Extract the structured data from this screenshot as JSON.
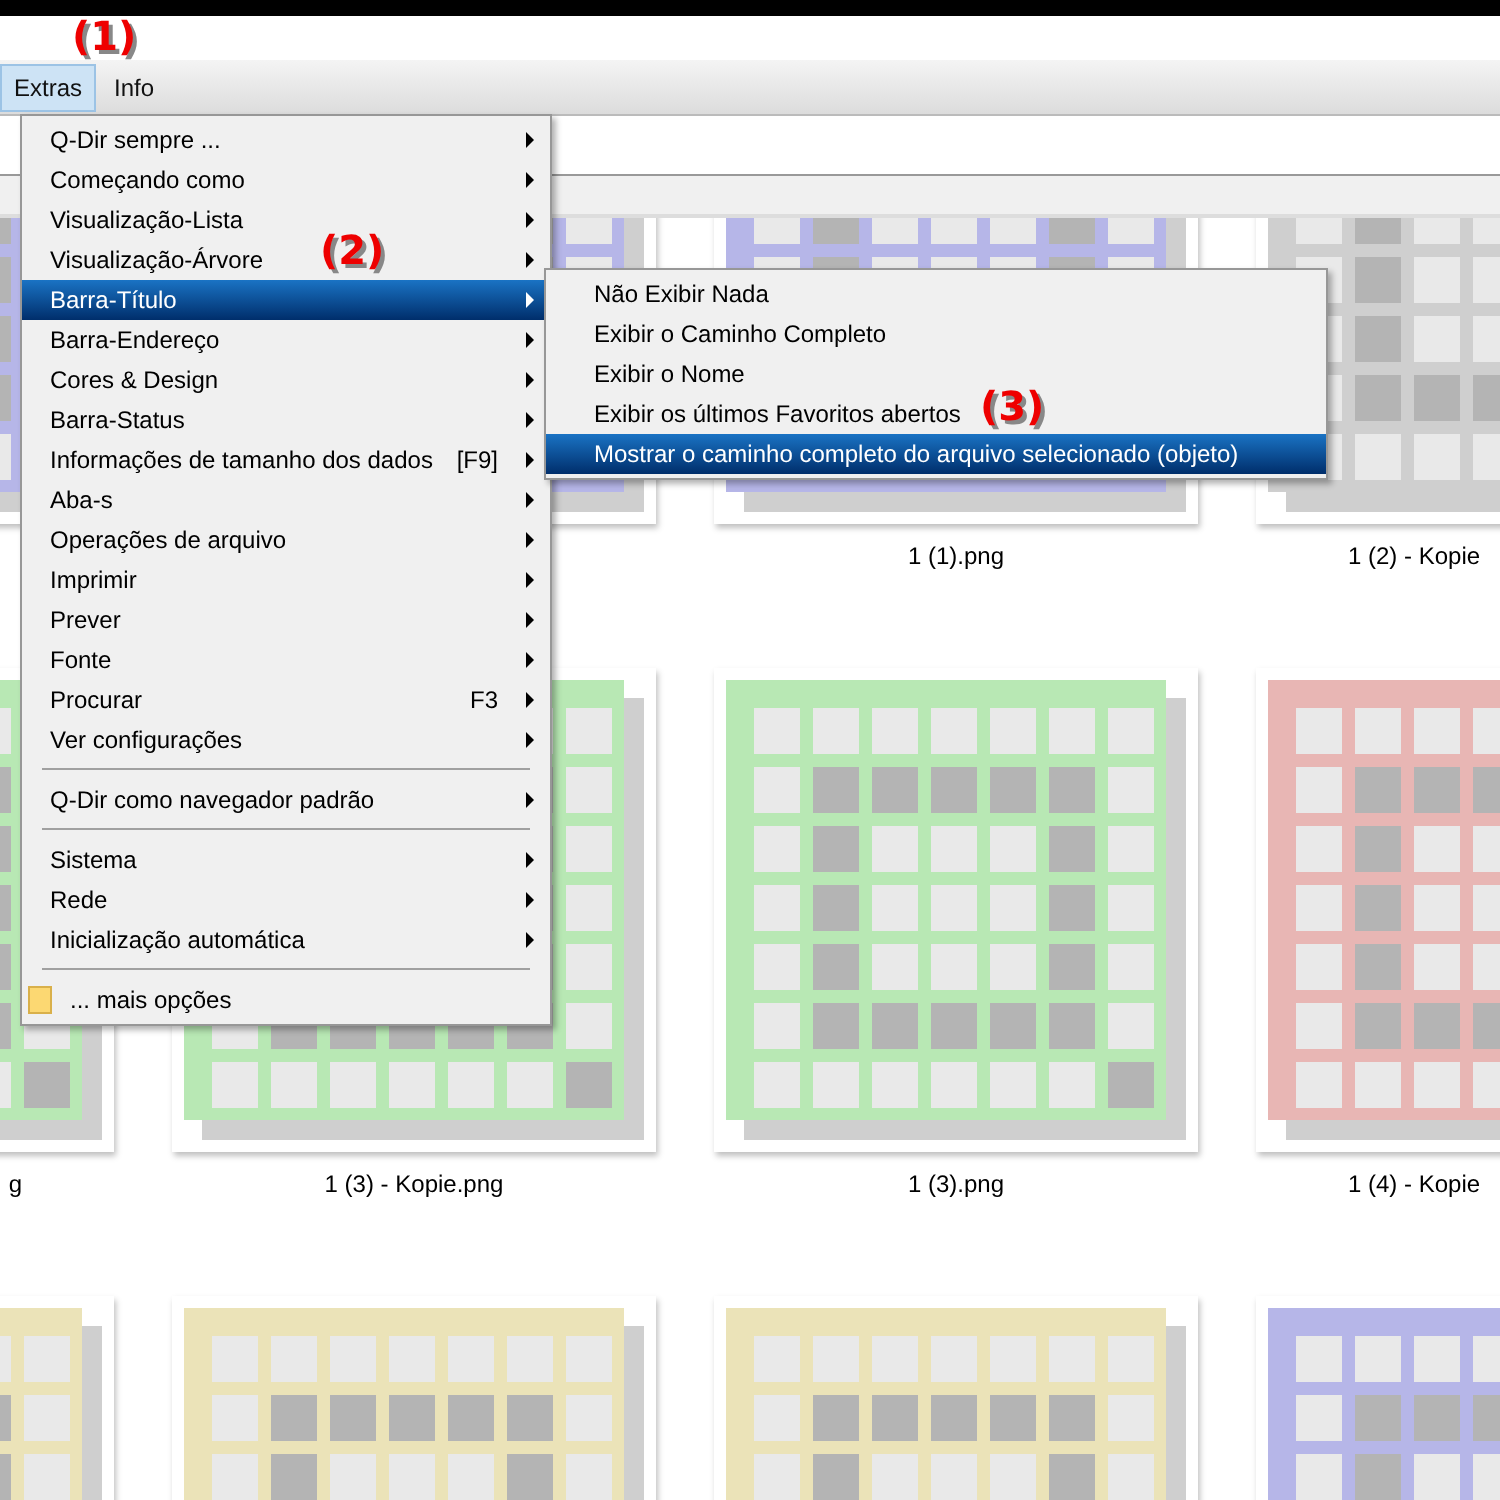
{
  "menubar": [
    {
      "label": "Extras",
      "selected": true
    },
    {
      "label": "Info",
      "selected": false
    }
  ],
  "menu": [
    {
      "kind": "item",
      "label": "Q-Dir sempre ...",
      "submenu": true,
      "selected": false
    },
    {
      "kind": "item",
      "label": "Começando como",
      "submenu": true,
      "selected": false
    },
    {
      "kind": "item",
      "label": "Visualização-Lista",
      "submenu": true,
      "selected": false
    },
    {
      "kind": "item",
      "label": "Visualização-Árvore",
      "submenu": true,
      "selected": false
    },
    {
      "kind": "item",
      "label": "Barra-Título",
      "submenu": true,
      "selected": true
    },
    {
      "kind": "item",
      "label": "Barra-Endereço",
      "submenu": true,
      "selected": false
    },
    {
      "kind": "item",
      "label": "Cores & Design",
      "submenu": true,
      "selected": false
    },
    {
      "kind": "item",
      "label": "Barra-Status",
      "submenu": true,
      "selected": false
    },
    {
      "kind": "item",
      "label": "Informações de tamanho dos dados",
      "shortcut": "[F9]",
      "submenu": true,
      "selected": false
    },
    {
      "kind": "item",
      "label": "Aba-s",
      "submenu": true,
      "selected": false
    },
    {
      "kind": "item",
      "label": "Operações de arquivo",
      "submenu": true,
      "selected": false
    },
    {
      "kind": "item",
      "label": "Imprimir",
      "submenu": true,
      "selected": false
    },
    {
      "kind": "item",
      "label": "Prever",
      "submenu": true,
      "selected": false
    },
    {
      "kind": "item",
      "label": "Fonte",
      "submenu": true,
      "selected": false
    },
    {
      "kind": "item",
      "label": "Procurar",
      "shortcut": "F3",
      "submenu": true,
      "selected": false
    },
    {
      "kind": "item",
      "label": "Ver configurações",
      "submenu": true,
      "selected": false
    },
    {
      "kind": "separator"
    },
    {
      "kind": "item",
      "label": "Q-Dir como navegador padrão",
      "submenu": true,
      "selected": false
    },
    {
      "kind": "separator"
    },
    {
      "kind": "item",
      "label": "Sistema",
      "submenu": true,
      "selected": false
    },
    {
      "kind": "item",
      "label": "Rede",
      "submenu": true,
      "selected": false
    },
    {
      "kind": "item",
      "label": "Inicialização automática",
      "submenu": true,
      "selected": false
    },
    {
      "kind": "separator"
    },
    {
      "kind": "folder",
      "label": "... mais opções",
      "submenu": false,
      "selected": false
    }
  ],
  "submenu": [
    {
      "label": "Não Exibir Nada",
      "selected": false
    },
    {
      "label": "Exibir o Caminho Completo",
      "selected": false
    },
    {
      "label": "Exibir o Nome",
      "selected": false
    },
    {
      "label": "Exibir os últimos Favoritos abertos",
      "selected": false
    },
    {
      "label": "Mostrar o caminho completo do arquivo selecionado (objeto)",
      "selected": true
    }
  ],
  "annotations": [
    {
      "text": "(1)"
    },
    {
      "text": "(2)"
    },
    {
      "text": "(3)"
    }
  ],
  "thumbnails": [
    {
      "color": "#b6b6e8"
    },
    {
      "color": "#b6b6e8"
    },
    {
      "color": "#b6b6e8",
      "label": "1 (1).png"
    },
    {
      "color": "#cfcfcf",
      "label": "1 (2) - Kopie"
    },
    {
      "color": "#b8e8b4",
      "label": "g"
    },
    {
      "color": "#b8e8b4",
      "label": "1 (3) - Kopie.png"
    },
    {
      "color": "#b8e8b4",
      "label": "1 (3).png"
    },
    {
      "color": "#e8b6b4",
      "label": "1 (4) - Kopie"
    },
    {
      "color": "#ebe3b8"
    },
    {
      "color": "#ebe3b8"
    },
    {
      "color": "#ebe3b8"
    },
    {
      "color": "#b6b6e8"
    }
  ]
}
